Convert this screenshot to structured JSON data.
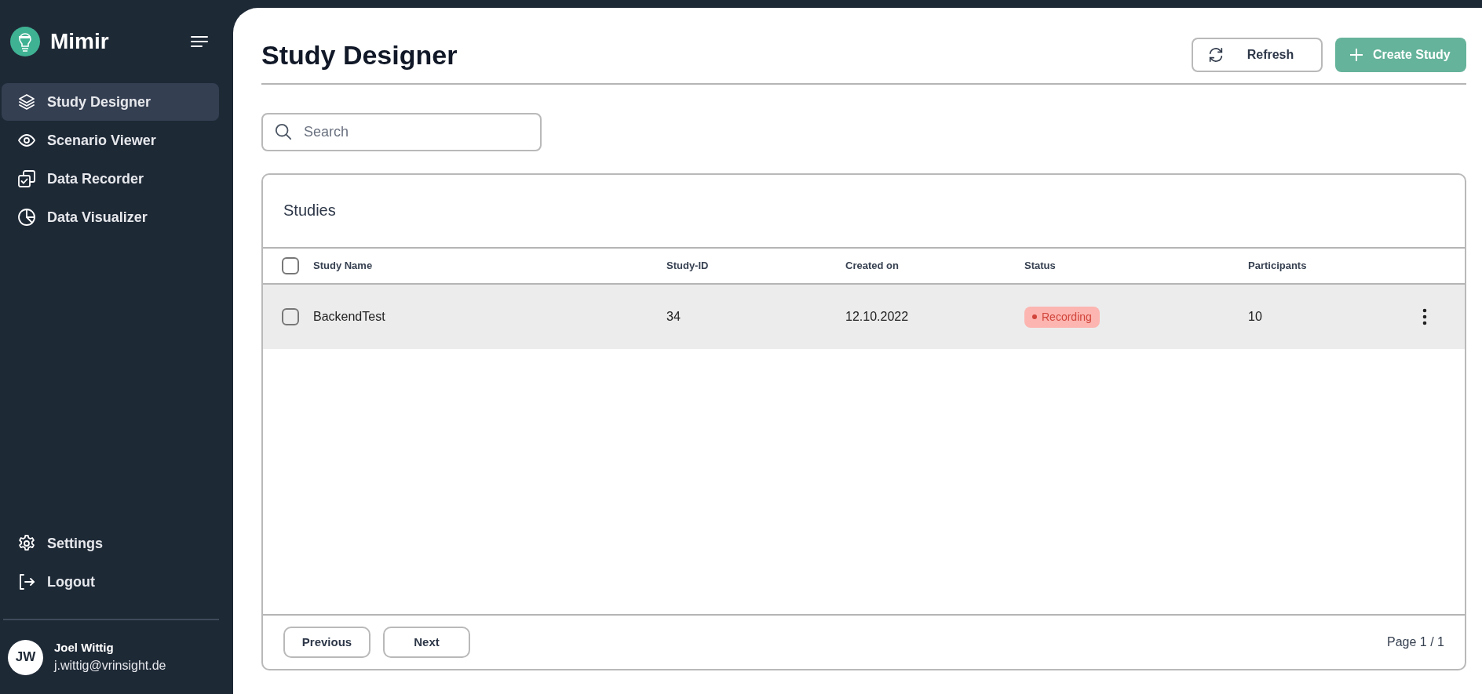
{
  "app": {
    "name": "Mimir"
  },
  "sidebar": {
    "items": [
      {
        "label": "Study Designer",
        "selected": true
      },
      {
        "label": "Scenario Viewer",
        "selected": false
      },
      {
        "label": "Data Recorder",
        "selected": false
      },
      {
        "label": "Data Visualizer",
        "selected": false
      }
    ],
    "bottom_items": [
      {
        "label": "Settings"
      },
      {
        "label": "Logout"
      }
    ],
    "user": {
      "initials": "JW",
      "name": "Joel Wittig",
      "email": "j.wittig@vrinsight.de"
    }
  },
  "page": {
    "title": "Study Designer",
    "buttons": [
      {
        "label": "Refresh",
        "kind": "outline"
      },
      {
        "label": "Create Study",
        "kind": "primary"
      }
    ]
  },
  "search": {
    "placeholder": "Search"
  },
  "table": {
    "title": "Studies",
    "header_checked": false,
    "columns": [
      "Study Name",
      "Study-ID",
      "Created on",
      "Status",
      "Participants"
    ],
    "rows": [
      {
        "checked": false,
        "hovered": true,
        "name": "BackendTest",
        "id": "34",
        "created": "12.10.2022",
        "status": {
          "label": "Recording",
          "kind": "recording"
        },
        "participants": "10"
      }
    ],
    "pagination": {
      "buttons": [
        "Previous",
        "Next"
      ],
      "page": "Page 1 / 1"
    }
  }
}
